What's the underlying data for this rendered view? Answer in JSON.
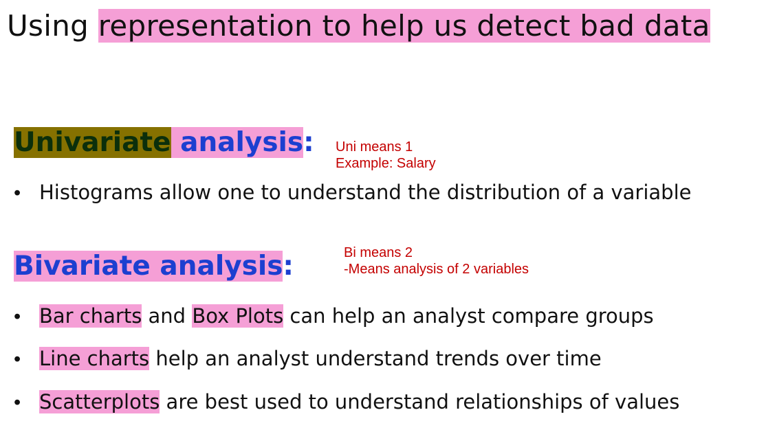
{
  "title": {
    "prefix": "Using ",
    "highlight": "representation to help us detect bad data"
  },
  "univariate": {
    "heading_word1": "Univariate",
    "heading_word2": " analysis",
    "colon": ":",
    "note_line1": "Uni means 1",
    "note_line2": "Example: Salary",
    "bullets": [
      {
        "text": "Histograms allow one to understand the distribution of a variable"
      }
    ]
  },
  "bivariate": {
    "heading_text": "Bivariate analysis",
    "colon": ":",
    "note_line1": "Bi means 2",
    "note_line2": "-Means analysis of 2 variables",
    "bullets": [
      {
        "hl1": "Bar charts",
        "mid": " and ",
        "hl2": "Box Plots",
        "rest": " can help an analyst compare groups"
      },
      {
        "hl1": "Line charts",
        "rest": " help an analyst understand trends over time"
      },
      {
        "hl1": "Scatterplots",
        "rest": " are best used to understand relationships of values"
      }
    ]
  },
  "bullet_glyph": "•"
}
